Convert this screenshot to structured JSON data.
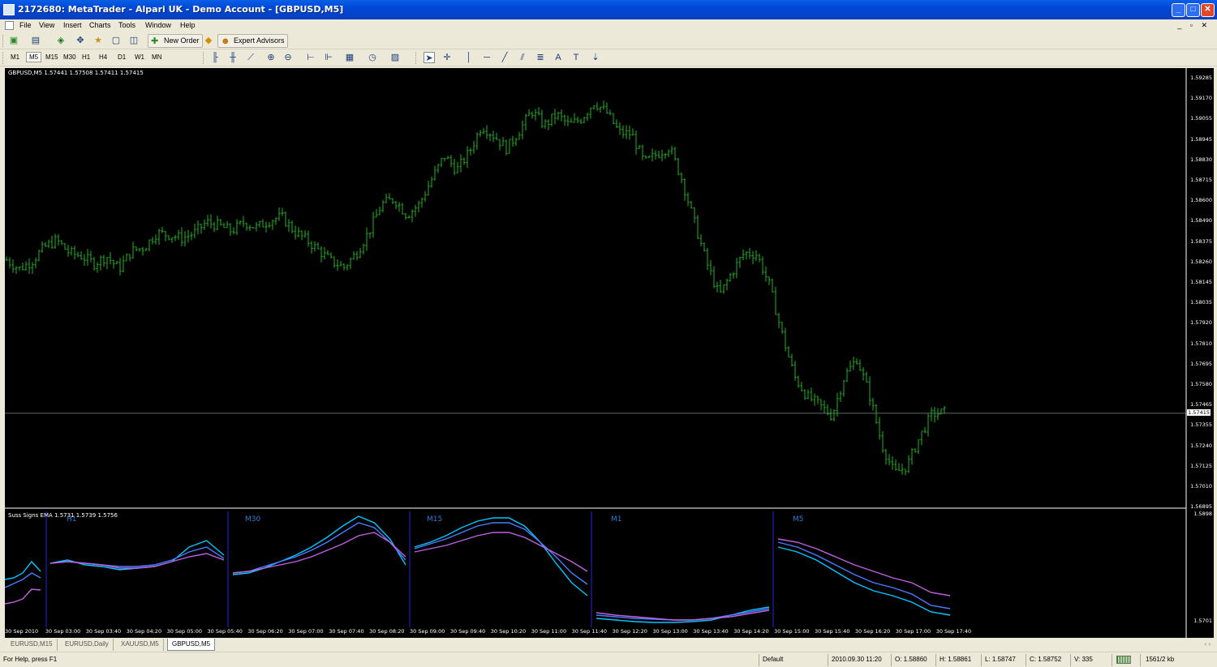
{
  "window": {
    "title": "2172680: MetaTrader - Alpari UK - Demo Account - [GBPUSD,M5]"
  },
  "menu": [
    "File",
    "View",
    "Insert",
    "Charts",
    "Tools",
    "Window",
    "Help"
  ],
  "toolbar": {
    "new_order": "New Order",
    "expert_advisors": "Expert Advisors"
  },
  "timeframes": [
    "M1",
    "M5",
    "M15",
    "M30",
    "H1",
    "H4",
    "D1",
    "W1",
    "MN"
  ],
  "active_timeframe": "M5",
  "chart": {
    "symbol_info": "GBPUSD,M5  1.57441 1.57508 1.57411 1.57415",
    "current_price": "1.57415",
    "price_axis": [
      "1.59285",
      "1.59170",
      "1.59055",
      "1.58945",
      "1.58830",
      "1.58715",
      "1.58600",
      "1.58490",
      "1.58375",
      "1.58260",
      "1.58145",
      "1.58035",
      "1.57920",
      "1.57810",
      "1.57695",
      "1.57580",
      "1.57465",
      "1.57355",
      "1.57240",
      "1.57125",
      "1.57010",
      "1.56895"
    ],
    "indicator_label": "Suss Signs EMA 1.5731 1.5739 1.5756",
    "indicator_axis_top": "1.5898",
    "indicator_axis_bottom": "1.5701",
    "segments": [
      "H1",
      "M30",
      "M15",
      "M1",
      "M5"
    ],
    "time_axis": [
      "30 Sep 2010",
      "30 Sep 03:00",
      "30 Sep 03:40",
      "30 Sep 04:20",
      "30 Sep 05:00",
      "30 Sep 05:40",
      "30 Sep 06:20",
      "30 Sep 07:00",
      "30 Sep 07:40",
      "30 Sep 08:20",
      "30 Sep 09:00",
      "30 Sep 09:40",
      "30 Sep 10:20",
      "30 Sep 11:00",
      "30 Sep 11:40",
      "30 Sep 12:20",
      "30 Sep 13:00",
      "30 Sep 13:40",
      "30 Sep 14:20",
      "30 Sep 15:00",
      "30 Sep 15:40",
      "30 Sep 16:20",
      "30 Sep 17:00",
      "30 Sep 17:40"
    ],
    "colors": {
      "bars": "#1fb51f",
      "ema_fast": "#00c8ff",
      "ema_mid": "#4a7cff",
      "ema_slow": "#c060e0",
      "separator": "#1a2bd6"
    }
  },
  "chart_data": {
    "type": "line",
    "title": "GBPUSD,M5",
    "ylim": [
      1.56895,
      1.59285
    ],
    "close_path": [
      1.5827,
      1.5822,
      1.5826,
      1.5834,
      1.5838,
      1.5831,
      1.5829,
      1.5825,
      1.5829,
      1.5822,
      1.5832,
      1.5834,
      1.5842,
      1.5841,
      1.5839,
      1.5842,
      1.5848,
      1.5846,
      1.5843,
      1.5848,
      1.5845,
      1.5849,
      1.5851,
      1.5843,
      1.5838,
      1.5832,
      1.5826,
      1.5823,
      1.5831,
      1.5843,
      1.5858,
      1.5861,
      1.5852,
      1.5858,
      1.5872,
      1.5885,
      1.5877,
      1.5887,
      1.5902,
      1.5896,
      1.5889,
      1.5899,
      1.591,
      1.5902,
      1.5908,
      1.5902,
      1.5906,
      1.5915,
      1.5909,
      1.5898,
      1.5897,
      1.5881,
      1.5886,
      1.589,
      1.5872,
      1.5848,
      1.5825,
      1.5807,
      1.582,
      1.5831,
      1.583,
      1.5813,
      1.5786,
      1.5762,
      1.5751,
      1.5746,
      1.574,
      1.5762,
      1.5772,
      1.5752,
      1.5724,
      1.5708,
      1.5712,
      1.5728,
      1.5741,
      1.5742
    ]
  },
  "tabs": [
    "EURUSD,M15",
    "EURUSD,Daily",
    "XAUUSD,M5",
    "GBPUSD,M5"
  ],
  "active_tab": "GBPUSD,M5",
  "status": {
    "help": "For Help, press F1",
    "profile": "Default",
    "datetime": "2010.09.30 11:20",
    "open": "O: 1.58860",
    "high": "H: 1.58861",
    "low": "L: 1.58747",
    "close": "C: 1.58752",
    "volume": "V: 335",
    "traffic": "1561/2 kb"
  }
}
